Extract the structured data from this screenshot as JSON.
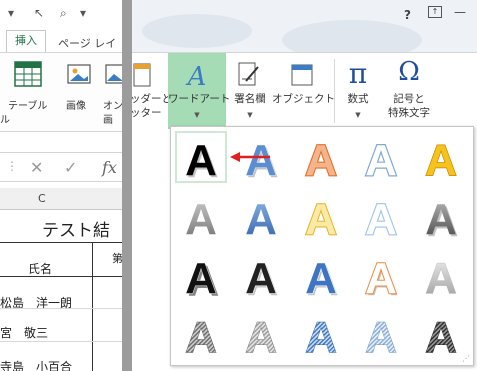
{
  "ribbon_left": {
    "tab_insert": "挿入",
    "tab_page_layout": "ページ レイ",
    "table_label": "テーブル",
    "table_label_cont": "ル",
    "image_label": "画像",
    "online_label_1": "オン",
    "online_label_2": "画",
    "shapes_label_1": "ッダーと",
    "shapes_label_2": "ッター"
  },
  "formula_bar": {
    "cancel_glyph": "✕",
    "enter_glyph": "✓",
    "fx_glyph": "fx"
  },
  "sheet": {
    "column_c": "C",
    "title_text": "テスト結",
    "header_name": "氏名",
    "header_next": "第",
    "rows": [
      "松島　洋一朗",
      "宮　敬三",
      "寺島　小百合"
    ]
  },
  "ribbon_right": {
    "wordart_label": "ワードアート",
    "signature_label": "署名欄",
    "object_label": "オブジェクト",
    "equation_label": "数式",
    "symbol_label_1": "記号と",
    "symbol_label_2": "特殊文字",
    "equation_glyph": "π",
    "symbol_glyph": "Ω",
    "help_glyph": "?",
    "wordart_glyph": "A"
  },
  "gallery": {
    "letter": "A",
    "selected_index": 0,
    "styles": [
      "fill-black-shadow",
      "fill-blue-accent1-shadow",
      "fill-orange-accent2-outline",
      "fill-white-outline-accent1",
      "fill-gold-accent4-soft-bevel",
      "gradient-gray",
      "gradient-blue-reflection",
      "fill-gold-outline-accent4",
      "fill-white-outline-accent1-glow",
      "gradient-gray-shadow",
      "fill-black-hard-shadow",
      "fill-black-outline-white-shadow",
      "fill-blue-outline-white-shadow",
      "fill-white-outline-accent2-shadow",
      "fill-gray-reflection",
      "pattern-gray-stripes",
      "pattern-light-gray",
      "pattern-blue-stripes",
      "pattern-light-blue",
      "pattern-dark-stripes"
    ]
  },
  "colors": {
    "accent_green": "#217346",
    "wordart_highlight": "#a5dbb5",
    "arrow_red": "#e02020",
    "divider_gray": "#9c9c9c"
  }
}
